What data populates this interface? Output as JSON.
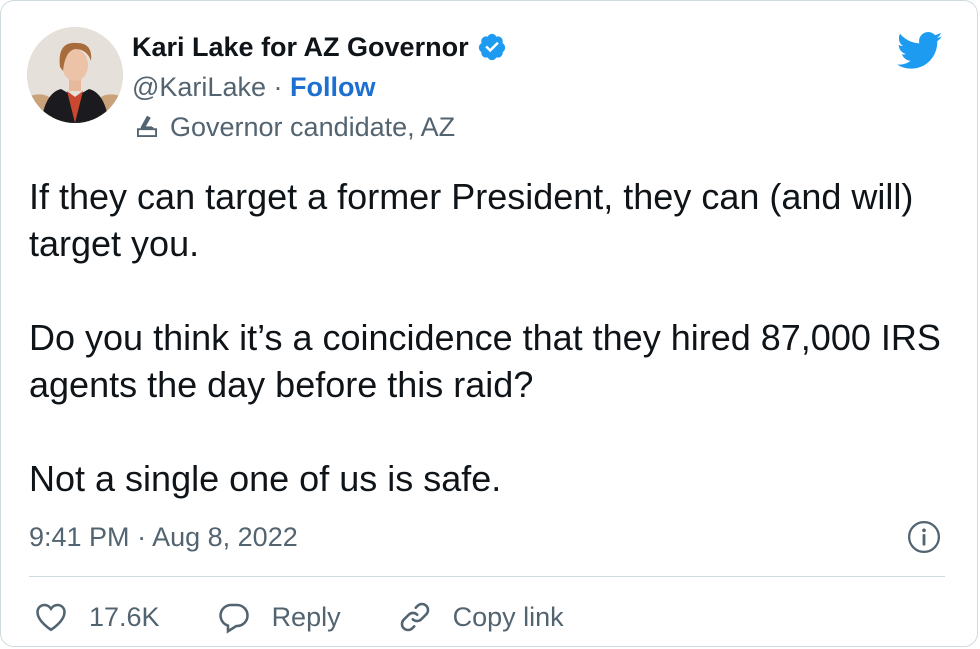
{
  "author": {
    "name": "Kari Lake for AZ Governor",
    "handle": "@KariLake",
    "separator": "·",
    "follow_label": "Follow",
    "label": "Governor candidate, AZ",
    "label_icon": "ballot-box-icon",
    "verified_icon": "verified-badge-icon"
  },
  "tweet": {
    "paragraphs": [
      "If they can target a former President, they can (and will) target you.",
      "Do you think it’s a coincidence that they hired 87,000 IRS agents the day before this raid?",
      "Not a single one of us is safe."
    ],
    "time": "9:41 PM",
    "separator": "·",
    "date": "Aug 8, 2022"
  },
  "actions": {
    "like_count": "17.6K",
    "reply_label": "Reply",
    "copy_link_label": "Copy link"
  },
  "colors": {
    "twitter_blue": "#1d9bf0",
    "follow_blue": "#1d6fd0",
    "secondary_text": "#536471",
    "border": "#cfd9de"
  }
}
